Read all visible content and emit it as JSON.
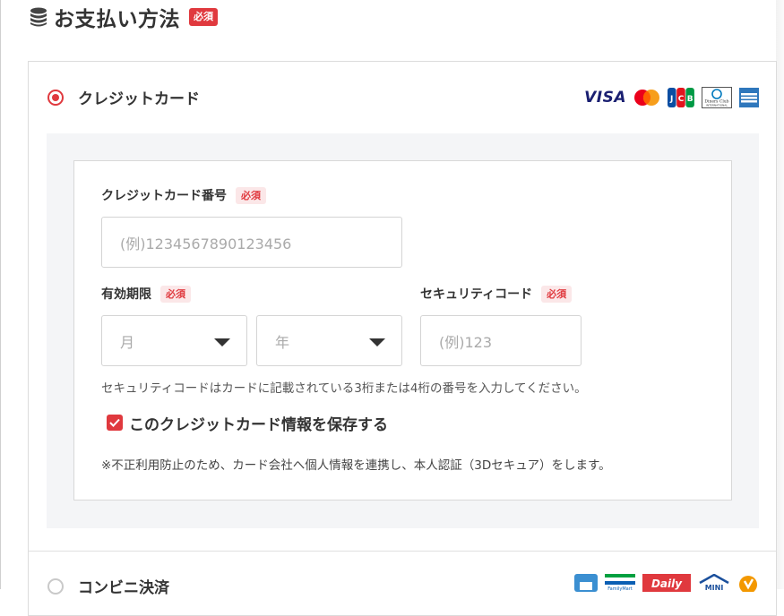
{
  "header": {
    "title": "お支払い方法",
    "required_badge": "必須",
    "icon": "coins-icon"
  },
  "credit_card": {
    "label": "クレジットカード",
    "selected": true,
    "brands": [
      {
        "name": "VISA",
        "icon": "visa-logo"
      },
      {
        "name": "Mastercard",
        "icon": "mastercard-logo"
      },
      {
        "name": "JCB",
        "icon": "jcb-logo"
      },
      {
        "name": "Diners Club International",
        "icon": "diners-logo"
      },
      {
        "name": "American Express",
        "icon": "amex-logo"
      }
    ],
    "diners_text": "Diners Club",
    "diners_subtext": "INTERNATIONAL",
    "card_number": {
      "label": "クレジットカード番号",
      "required_badge": "必須",
      "placeholder": "(例)1234567890123456",
      "value": ""
    },
    "expiry": {
      "label": "有効期限",
      "required_badge": "必須",
      "month_placeholder": "月",
      "year_placeholder": "年"
    },
    "security_code": {
      "label": "セキュリティコード",
      "required_badge": "必須",
      "placeholder": "(例)123"
    },
    "security_help": "セキュリティコードはカードに記載されている3桁または4桁の番号を入力してください。",
    "save_card": {
      "label": "このクレジットカード情報を保存する",
      "checked": true
    },
    "note": "※不正利用防止のため、カード会社へ個人情報を連携し、本人認証（3Dセキュア）をします。"
  },
  "convenience": {
    "label": "コンビニ決済",
    "selected": false,
    "logos": [
      "lawson-logo",
      "familymart-logo",
      "daily-yamazaki-logo",
      "ministop-logo",
      "seicomart-logo"
    ],
    "familymart_text": "FamilyMart",
    "daily_text": "Daily",
    "ministop_text": "MINI"
  },
  "colors": {
    "accent": "#e0393e",
    "panel_bg": "#f4f5f7",
    "visa": "#1a1f71"
  }
}
